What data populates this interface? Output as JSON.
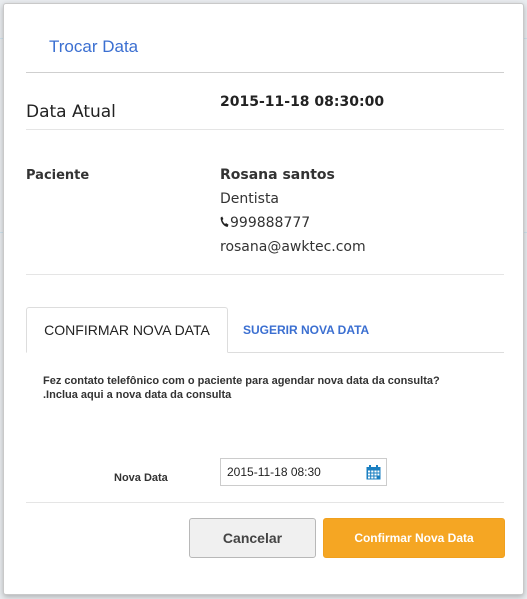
{
  "modal": {
    "title": "Trocar Data"
  },
  "current_date": {
    "label": "Data Atual",
    "value": "2015-11-18 08:30:00"
  },
  "patient": {
    "label": "Paciente",
    "name": "Rosana santos",
    "specialty": "Dentista",
    "phone": "999888777",
    "email": "rosana@awktec.com",
    "phone_icon": "phone-icon"
  },
  "tabs": [
    {
      "label": "CONFIRMAR NOVA DATA",
      "active": true
    },
    {
      "label": "SUGERIR NOVA DATA",
      "active": false
    }
  ],
  "info": {
    "line1": "Fez contato telefônico com o paciente para agendar nova data da consulta?",
    "line2": ".Inclua aqui a nova data da consulta"
  },
  "new_date": {
    "label": "Nova Data",
    "value": "2015-11-18 08:30",
    "icon": "calendar-icon"
  },
  "buttons": {
    "cancel": "Cancelar",
    "confirm": "Confirmar Nova Data"
  },
  "colors": {
    "accent_blue": "#3b6fd1",
    "confirm_orange": "#f5a623",
    "calendar_blue": "#1a7fc1"
  }
}
